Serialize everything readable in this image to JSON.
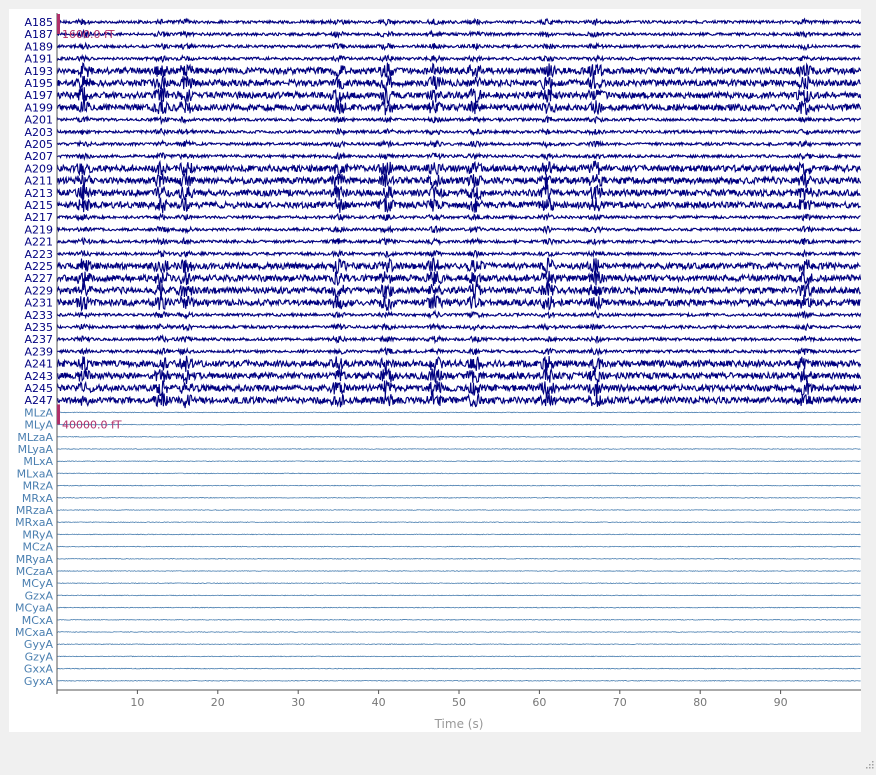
{
  "chart_data": {
    "type": "line",
    "xlabel": "Time (s)",
    "xlim": [
      0,
      100
    ],
    "xticks": [
      10,
      20,
      30,
      40,
      50,
      60,
      70,
      80,
      90
    ],
    "grid": false,
    "groups": [
      {
        "color": "#000080",
        "scale_label": "1600.0 fT",
        "channels": [
          "A185",
          "A187",
          "A189",
          "A191",
          "A193",
          "A195",
          "A197",
          "A199",
          "A201",
          "A203",
          "A205",
          "A207",
          "A209",
          "A211",
          "A213",
          "A215",
          "A217",
          "A219",
          "A221",
          "A223",
          "A225",
          "A227",
          "A229",
          "A231",
          "A233",
          "A235",
          "A237",
          "A239",
          "A241",
          "A243",
          "A245",
          "A247"
        ]
      },
      {
        "color": "#4a7fb0",
        "scale_label": "40000.0 fT",
        "channels": [
          "MLzA",
          "MLyA",
          "MLzaA",
          "MLyaA",
          "MLxA",
          "MLxaA",
          "MRzA",
          "MRxA",
          "MRzaA",
          "MRxaA",
          "MRyA",
          "MCzA",
          "MRyaA",
          "MCzaA",
          "MCyA",
          "GzxA",
          "MCyaA",
          "MCxA",
          "MCxaA",
          "GyyA",
          "GzyA",
          "GxxA",
          "GyxA"
        ]
      }
    ],
    "scale_bar_color": "#b0306a",
    "events": [
      3.3,
      13,
      16,
      35,
      41,
      47,
      52,
      61,
      67,
      93
    ]
  }
}
